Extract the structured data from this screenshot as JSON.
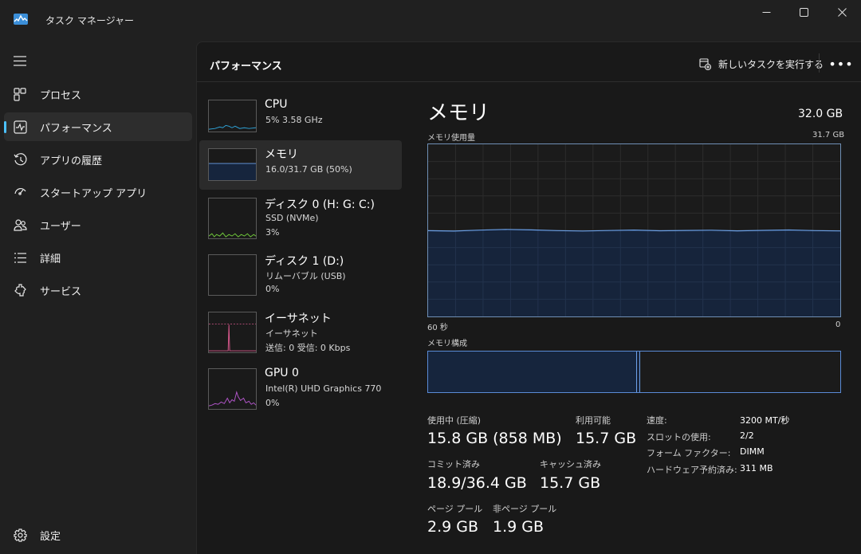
{
  "window": {
    "title": "タスク マネージャー"
  },
  "sidebar": {
    "items": [
      {
        "label": "プロセス",
        "icon": "process-icon"
      },
      {
        "label": "パフォーマンス",
        "icon": "performance-icon",
        "active": true
      },
      {
        "label": "アプリの履歴",
        "icon": "history-icon"
      },
      {
        "label": "スタートアップ アプリ",
        "icon": "startup-icon"
      },
      {
        "label": "ユーザー",
        "icon": "users-icon"
      },
      {
        "label": "詳細",
        "icon": "details-icon"
      },
      {
        "label": "サービス",
        "icon": "services-icon"
      }
    ],
    "settings": {
      "label": "設定",
      "icon": "gear-icon"
    }
  },
  "header": {
    "title": "パフォーマンス",
    "run_task_label": "新しいタスクを実行する",
    "more_label": "•••"
  },
  "resources": [
    {
      "name": "CPU",
      "sub1": "5%  3.58 GHz",
      "color": "#2ea3d8"
    },
    {
      "name": "メモリ",
      "sub1": "16.0/31.7 GB (50%)",
      "color": "#4a7fd0",
      "active": true
    },
    {
      "name": "ディスク 0 (H: G: C:)",
      "sub1": "SSD (NVMe)",
      "sub2": "3%",
      "color": "#6fc73a"
    },
    {
      "name": "ディスク 1 (D:)",
      "sub1": "リムーバブル (USB)",
      "sub2": "0%",
      "color": "#6fc73a"
    },
    {
      "name": "イーサネット",
      "sub1": "イーサネット",
      "sub2": "送信: 0  受信: 0 Kbps",
      "color": "#d8588c"
    },
    {
      "name": "GPU 0",
      "sub1": "Intel(R) UHD Graphics 770",
      "sub2": "0%",
      "color": "#b155c9"
    }
  ],
  "detail": {
    "title": "メモリ",
    "capacity": "32.0 GB",
    "graph_label": "メモリ使用量",
    "graph_max": "31.7 GB",
    "time_left": "60 秒",
    "time_right": "0",
    "composition_label": "メモリ構成",
    "usage_fraction": 0.5,
    "stats": {
      "in_use_label": "使用中 (圧縮)",
      "in_use_value": "15.8 GB (858 MB)",
      "available_label": "利用可能",
      "available_value": "15.7 GB",
      "committed_label": "コミット済み",
      "committed_value": "18.9/36.4 GB",
      "cached_label": "キャッシュ済み",
      "cached_value": "15.7 GB",
      "paged_label": "ページ プール",
      "paged_value": "2.9 GB",
      "nonpaged_label": "非ページ プール",
      "nonpaged_value": "1.9 GB"
    },
    "props": [
      {
        "label": "速度:",
        "value": "3200 MT/秒"
      },
      {
        "label": "スロットの使用:",
        "value": "2/2"
      },
      {
        "label": "フォーム ファクター:",
        "value": "DIMM"
      },
      {
        "label": "ハードウェア予約済み:",
        "value": "311 MB"
      }
    ]
  },
  "colors": {
    "accent": "#4cc2ff",
    "memory_line": "#6aa0e8",
    "memory_fill": "#16253d"
  }
}
